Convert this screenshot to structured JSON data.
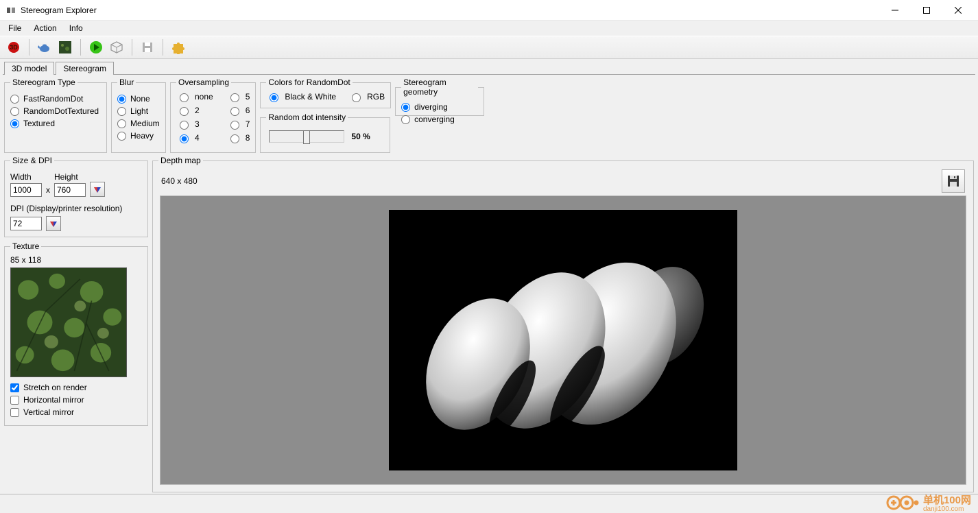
{
  "window": {
    "title": "Stereogram Explorer"
  },
  "menu": {
    "file": "File",
    "action": "Action",
    "info": "Info"
  },
  "tabs": {
    "model": "3D model",
    "stereogram": "Stereogram"
  },
  "groups": {
    "stereotype": {
      "legend": "Stereogram Type",
      "opt_fast": "FastRandomDot",
      "opt_rdt": "RandomDotTextured",
      "opt_tex": "Textured"
    },
    "blur": {
      "legend": "Blur",
      "none": "None",
      "light": "Light",
      "medium": "Medium",
      "heavy": "Heavy"
    },
    "oversampling": {
      "legend": "Oversampling",
      "none": "none",
      "v2": "2",
      "v3": "3",
      "v4": "4",
      "v5": "5",
      "v6": "6",
      "v7": "7",
      "v8": "8"
    },
    "colors": {
      "legend": "Colors for RandomDot",
      "bw": "Black & White",
      "rgb": "RGB"
    },
    "rdint": {
      "legend": "Random dot intensity",
      "value": "50 %"
    },
    "geometry": {
      "legend": "Stereogram geometry",
      "div": "diverging",
      "conv": "converging"
    },
    "size": {
      "legend": "Size & DPI",
      "width_label": "Width",
      "height_label": "Height",
      "width": "1000",
      "height": "760",
      "x": "x",
      "dpi_label": "DPI (Display/printer resolution)",
      "dpi": "72"
    },
    "texture": {
      "legend": "Texture",
      "dims": "85 x 118",
      "stretch": "Stretch on render",
      "hmirror": "Horizontal mirror",
      "vmirror": "Vertical mirror"
    },
    "depth": {
      "legend": "Depth map",
      "dims": "640 x 480"
    }
  },
  "watermark": {
    "main": "单机100网",
    "sub": "danji100.com"
  }
}
